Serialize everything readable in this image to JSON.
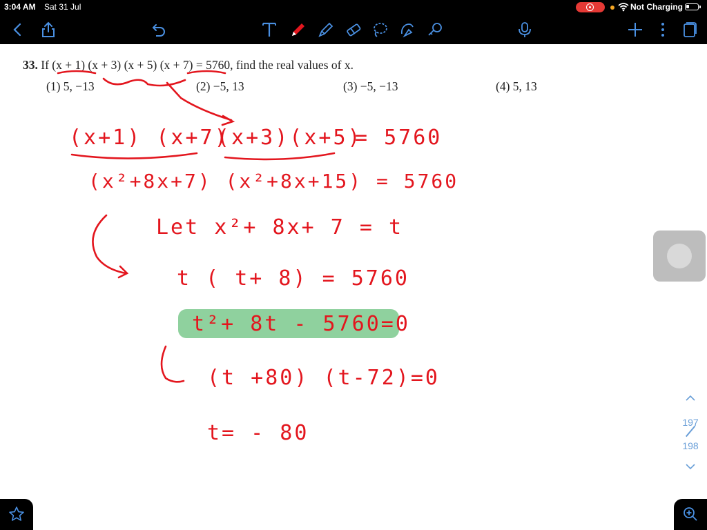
{
  "status": {
    "time": "3:04 AM",
    "date": "Sat 31 Jul",
    "charging": "Not Charging"
  },
  "toolbar": {
    "left": [
      "back-icon",
      "share-icon",
      "undo-icon"
    ],
    "tools": [
      "text-tool-icon",
      "pen-tool-icon",
      "highlighter-tool-icon",
      "eraser-tool-icon",
      "lasso-tool-icon",
      "shapes-tool-icon",
      "link-tool-icon"
    ],
    "right": [
      "microphone-icon",
      "add-icon",
      "more-icon",
      "pages-icon"
    ]
  },
  "question": {
    "number": "33.",
    "text": "If (x + 1) (x + 3) (x + 5) (x + 7) = 5760, find the real values of x.",
    "options": [
      "(1)  5, −13",
      "(2)  −5, 13",
      "(3)  −5, −13",
      "(4)  5, 13"
    ]
  },
  "handwriting": {
    "line1a": "(x+1) (x+7)",
    "line1b": "(x+3)(x+5)",
    "line1c": "= 5760",
    "line2": "(x²+8x+7) (x²+8x+15) = 5760",
    "line3": "Let x²+ 8x+ 7 = t",
    "line4": "t ( t+ 8) = 5760",
    "line5": "t²+ 8t - 5760=0",
    "line6": "(t +80) (t-72)=0",
    "line7": "t= - 80"
  },
  "pager": {
    "current": "197",
    "total": "198"
  },
  "colors": {
    "ink": "#e3161e",
    "highlight": "#8fd19e",
    "accent": "#4a90e2"
  }
}
